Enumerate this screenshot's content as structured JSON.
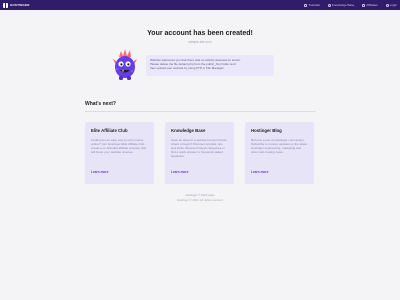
{
  "header": {
    "logo_text": "HOSTINGER",
    "nav": [
      {
        "label": "Tutorials",
        "icon": "book-icon"
      },
      {
        "label": "Knowledge Base",
        "icon": "lightbulb-icon"
      },
      {
        "label": "Affiliates",
        "icon": "handshake-icon"
      },
      {
        "label": "Login",
        "icon": "user-icon"
      }
    ]
  },
  "main": {
    "title": "Your account has been created!",
    "domain": "sample-site.com",
    "welcome_lines": [
      "Website welcomes you that there was no activity detected on server.",
      "Please delete the file default.php from the public_html folder and",
      "then upload your website by using FTP or File Manager."
    ]
  },
  "whats_next": {
    "heading": "What's next?",
    "cards": [
      {
        "title": "Elite Affiliate Club",
        "desc": "Looking for an easy way to earn money online? Join Hostinger Elite Affiliate club - create a co-branded affiliate program that will boost your website revenue.",
        "link": "Learn more"
      },
      {
        "title": "Knowledge Base",
        "desc": "Have an idea for a website but don't know where to begin? Discover tutorials, tips and tricks. Browse through categories or find a quick answer to frequently asked questions.",
        "link": "Learn more"
      },
      {
        "title": "Hostinger Blog",
        "desc": "Become a part of Hostinger community! Subscribe to receive updates on the latest Hostinger engineering, marketing and other web-hosting news.",
        "link": "Learn more"
      }
    ]
  },
  "footer": {
    "line1": "Hostinger © 2024 page",
    "line2": "Hostinger © 2024. All rights reserved."
  },
  "colors": {
    "header_bg": "#2f1c6a",
    "accent": "#673de6",
    "card_bg": "#e8e4f8",
    "page_bg": "#f4f4f6"
  }
}
